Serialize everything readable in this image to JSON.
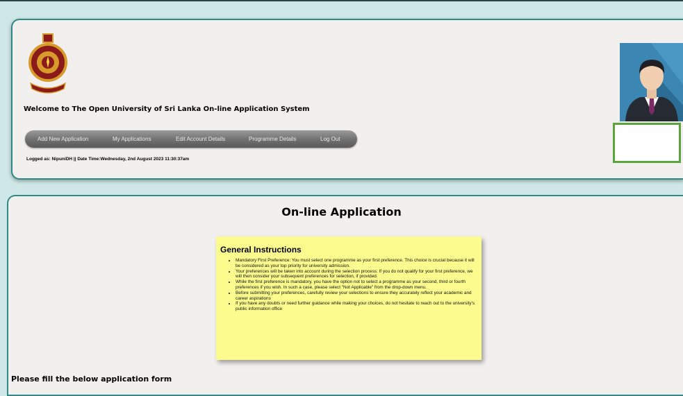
{
  "header": {
    "welcome": "Welcome to The Open University of Sri Lanka On-line Application System",
    "logged_info": "Logged as: NipuniDH || Date Time:Wednesday, 2nd August 2023 11:30:37am"
  },
  "nav": {
    "items": [
      "Add New Application",
      "My Applications",
      "Edit Account Details",
      "Programme Details",
      "Log Out"
    ]
  },
  "main": {
    "title": "On-line Application",
    "instructions": {
      "title": "General Instructions",
      "items": [
        "Mandatory First Preference: You must select one programme as your first preference. This choice is crucial because it will be considered as your top priority for university admission.",
        "Your preferences will be taken into account during the selection process. If you do not qualify for your first preference, we will then consider your subsequent preferences for selection, if provided.",
        "While the first preference is mandatory, you have the option not to select a programme as your second, third or fourth preferences if you wish. In such a case, please select \"Not Applicable\" from the drop-down menu.",
        "Before submitting your preferences, carefully review your selections to ensure they accurately reflect your academic and career aspirations",
        "If you have any doubts or need further guidance while making your choices, do not hesitate to reach out to the university's public information office"
      ]
    },
    "form_note": "Please fill the below application form"
  },
  "icons": {
    "logo": "university-crest-icon",
    "avatar": "user-avatar-icon"
  },
  "colors": {
    "background": "#cfe7e6",
    "panel_border": "#2f8a86",
    "instruction_bg": "#fbfb8e",
    "avatar_frame": "#5aa43b",
    "nav_bar": "#777777"
  }
}
